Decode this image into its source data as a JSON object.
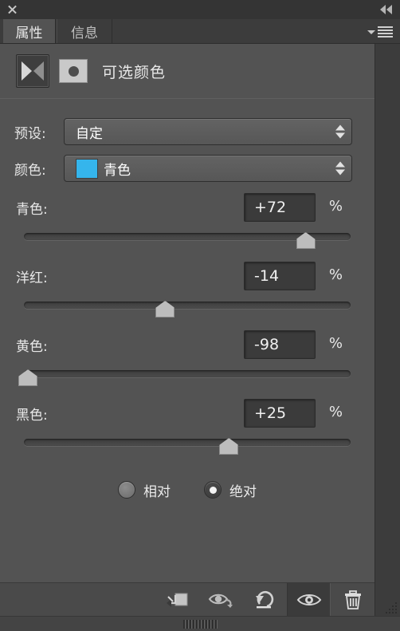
{
  "window": {
    "close_icon": "close-icon",
    "collapse_icon": "double-chevron-left-icon"
  },
  "tabs": [
    {
      "label": "属性",
      "active": true
    },
    {
      "label": "信息",
      "active": false
    }
  ],
  "panel_menu_icon": "hamburger-menu-icon",
  "adjustment": {
    "type_icon": "selective-color-adjustment-icon",
    "mask_icon": "layer-mask-thumbnail-icon",
    "title": "可选颜色"
  },
  "preset": {
    "label": "预设:",
    "value": "自定"
  },
  "colors": {
    "label": "颜色:",
    "value": "青色",
    "swatch_color": "#35b5ec"
  },
  "sliders": [
    {
      "label": "青色:",
      "value": "+72",
      "unit": "%",
      "percent": 86
    },
    {
      "label": "洋红:",
      "value": "-14",
      "unit": "%",
      "percent": 43
    },
    {
      "label": "黄色:",
      "value": "-98",
      "unit": "%",
      "percent": 1
    },
    {
      "label": "黑色:",
      "value": "+25",
      "unit": "%",
      "percent": 62.5
    }
  ],
  "method": {
    "relative": {
      "label": "相对",
      "selected": false
    },
    "absolute": {
      "label": "绝对",
      "selected": true
    }
  },
  "toolbar": [
    {
      "name": "clip-to-layer-icon",
      "active": false
    },
    {
      "name": "view-previous-state-icon",
      "active": false
    },
    {
      "name": "reset-icon",
      "active": false
    },
    {
      "name": "toggle-layer-visibility-icon",
      "active": true
    },
    {
      "name": "delete-adjustment-layer-icon",
      "active": false
    }
  ],
  "resize_grip_icon": "resize-grip-icon",
  "drag_handle_icon": "panel-drag-handle-icon"
}
